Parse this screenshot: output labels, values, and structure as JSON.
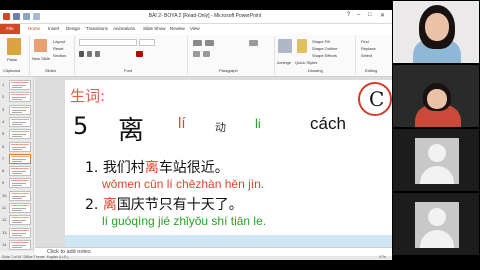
{
  "window": {
    "title": "BÀI 2- BOYA 2 [Read-Only] - Microsoft PowerPoint",
    "controls": [
      "?",
      "–",
      "□",
      "✕"
    ]
  },
  "ribbon": {
    "tabs": [
      "File",
      "Home",
      "Insert",
      "Design",
      "Transitions",
      "Animations",
      "Slide Show",
      "Review",
      "View"
    ],
    "active_tab": "Home",
    "groups": [
      "Clipboard",
      "Slides",
      "Font",
      "Paragraph",
      "Drawing",
      "Editing"
    ],
    "items": {
      "paste": "Paste",
      "new_slide": "New Slide",
      "layout": "Layout",
      "reset": "Reset",
      "section": "Section",
      "arrange": "Arrange",
      "quick_styles": "Quick Styles",
      "shape_fill": "Shape Fill",
      "shape_outline": "Shape Outline",
      "shape_effects": "Shape Effects",
      "find": "Find",
      "replace": "Replace",
      "select": "Select"
    }
  },
  "thumbnails": {
    "numbers": [
      "1",
      "2",
      "3",
      "4",
      "5",
      "6",
      "7",
      "8",
      "9",
      "10",
      "11",
      "12",
      "13",
      "14"
    ],
    "selected": 7
  },
  "slide": {
    "heading": "生词:",
    "number": "5",
    "character": "离",
    "pinyin": "lí",
    "part_of_speech": "动",
    "viet_reading": "li",
    "meaning": "cách",
    "example1": {
      "index": "1.",
      "pre": "我们村",
      "highlight": "离",
      "post": "车站很近。",
      "pinyin": "wǒmen cūn lí chēzhàn hěn jìn."
    },
    "example2": {
      "index": "2.",
      "highlight": "离",
      "post": "国庆节只有十天了。",
      "pinyin": "lí guóqìng jié zhǐyǒu shí tiān le."
    },
    "logo_letter": "C"
  },
  "notes": {
    "placeholder": "Click to add notes"
  },
  "statusbar": {
    "slide_info": "Slide 7 of 61   \"Office Theme\"   English (U.S.)",
    "zoom": "97%"
  },
  "colors": {
    "file_tab": "#d24726",
    "accent_red": "#e0462e",
    "accent_green": "#2aa02a",
    "logo_ring": "#d23c2c"
  }
}
